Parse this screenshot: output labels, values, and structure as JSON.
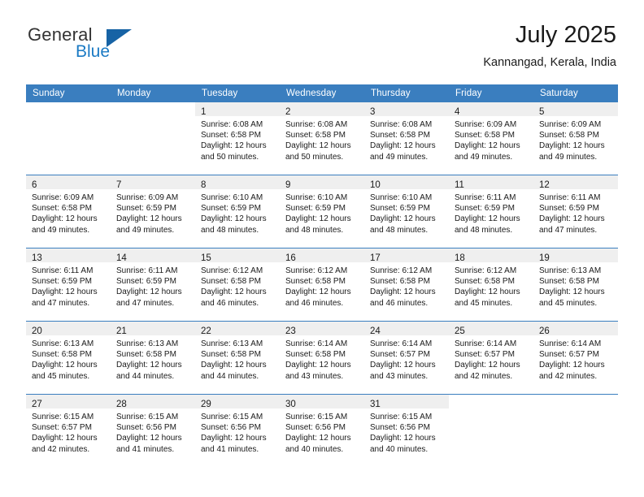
{
  "brand": {
    "name_part1": "General",
    "name_part2": "Blue",
    "triangle_color": "#1763a5",
    "blue_color": "#1b7ac4"
  },
  "header": {
    "title": "July 2025",
    "location": "Kannangad, Kerala, India"
  },
  "theme": {
    "header_band": "#3a7ebf",
    "daynum_band": "#efefef",
    "row_divider": "#3a7ebf",
    "text": "#1a1a1a"
  },
  "weekdays": [
    "Sunday",
    "Monday",
    "Tuesday",
    "Wednesday",
    "Thursday",
    "Friday",
    "Saturday"
  ],
  "labels": {
    "sunrise_prefix": "Sunrise: ",
    "sunset_prefix": "Sunset: ",
    "daylight_prefix": "Daylight: "
  },
  "weeks": [
    [
      {
        "day": "",
        "sunrise": "",
        "sunset": "",
        "daylight_l1": "",
        "daylight_l2": ""
      },
      {
        "day": "",
        "sunrise": "",
        "sunset": "",
        "daylight_l1": "",
        "daylight_l2": ""
      },
      {
        "day": "1",
        "sunrise": "Sunrise: 6:08 AM",
        "sunset": "Sunset: 6:58 PM",
        "daylight_l1": "Daylight: 12 hours",
        "daylight_l2": "and 50 minutes."
      },
      {
        "day": "2",
        "sunrise": "Sunrise: 6:08 AM",
        "sunset": "Sunset: 6:58 PM",
        "daylight_l1": "Daylight: 12 hours",
        "daylight_l2": "and 50 minutes."
      },
      {
        "day": "3",
        "sunrise": "Sunrise: 6:08 AM",
        "sunset": "Sunset: 6:58 PM",
        "daylight_l1": "Daylight: 12 hours",
        "daylight_l2": "and 49 minutes."
      },
      {
        "day": "4",
        "sunrise": "Sunrise: 6:09 AM",
        "sunset": "Sunset: 6:58 PM",
        "daylight_l1": "Daylight: 12 hours",
        "daylight_l2": "and 49 minutes."
      },
      {
        "day": "5",
        "sunrise": "Sunrise: 6:09 AM",
        "sunset": "Sunset: 6:58 PM",
        "daylight_l1": "Daylight: 12 hours",
        "daylight_l2": "and 49 minutes."
      }
    ],
    [
      {
        "day": "6",
        "sunrise": "Sunrise: 6:09 AM",
        "sunset": "Sunset: 6:58 PM",
        "daylight_l1": "Daylight: 12 hours",
        "daylight_l2": "and 49 minutes."
      },
      {
        "day": "7",
        "sunrise": "Sunrise: 6:09 AM",
        "sunset": "Sunset: 6:59 PM",
        "daylight_l1": "Daylight: 12 hours",
        "daylight_l2": "and 49 minutes."
      },
      {
        "day": "8",
        "sunrise": "Sunrise: 6:10 AM",
        "sunset": "Sunset: 6:59 PM",
        "daylight_l1": "Daylight: 12 hours",
        "daylight_l2": "and 48 minutes."
      },
      {
        "day": "9",
        "sunrise": "Sunrise: 6:10 AM",
        "sunset": "Sunset: 6:59 PM",
        "daylight_l1": "Daylight: 12 hours",
        "daylight_l2": "and 48 minutes."
      },
      {
        "day": "10",
        "sunrise": "Sunrise: 6:10 AM",
        "sunset": "Sunset: 6:59 PM",
        "daylight_l1": "Daylight: 12 hours",
        "daylight_l2": "and 48 minutes."
      },
      {
        "day": "11",
        "sunrise": "Sunrise: 6:11 AM",
        "sunset": "Sunset: 6:59 PM",
        "daylight_l1": "Daylight: 12 hours",
        "daylight_l2": "and 48 minutes."
      },
      {
        "day": "12",
        "sunrise": "Sunrise: 6:11 AM",
        "sunset": "Sunset: 6:59 PM",
        "daylight_l1": "Daylight: 12 hours",
        "daylight_l2": "and 47 minutes."
      }
    ],
    [
      {
        "day": "13",
        "sunrise": "Sunrise: 6:11 AM",
        "sunset": "Sunset: 6:59 PM",
        "daylight_l1": "Daylight: 12 hours",
        "daylight_l2": "and 47 minutes."
      },
      {
        "day": "14",
        "sunrise": "Sunrise: 6:11 AM",
        "sunset": "Sunset: 6:59 PM",
        "daylight_l1": "Daylight: 12 hours",
        "daylight_l2": "and 47 minutes."
      },
      {
        "day": "15",
        "sunrise": "Sunrise: 6:12 AM",
        "sunset": "Sunset: 6:58 PM",
        "daylight_l1": "Daylight: 12 hours",
        "daylight_l2": "and 46 minutes."
      },
      {
        "day": "16",
        "sunrise": "Sunrise: 6:12 AM",
        "sunset": "Sunset: 6:58 PM",
        "daylight_l1": "Daylight: 12 hours",
        "daylight_l2": "and 46 minutes."
      },
      {
        "day": "17",
        "sunrise": "Sunrise: 6:12 AM",
        "sunset": "Sunset: 6:58 PM",
        "daylight_l1": "Daylight: 12 hours",
        "daylight_l2": "and 46 minutes."
      },
      {
        "day": "18",
        "sunrise": "Sunrise: 6:12 AM",
        "sunset": "Sunset: 6:58 PM",
        "daylight_l1": "Daylight: 12 hours",
        "daylight_l2": "and 45 minutes."
      },
      {
        "day": "19",
        "sunrise": "Sunrise: 6:13 AM",
        "sunset": "Sunset: 6:58 PM",
        "daylight_l1": "Daylight: 12 hours",
        "daylight_l2": "and 45 minutes."
      }
    ],
    [
      {
        "day": "20",
        "sunrise": "Sunrise: 6:13 AM",
        "sunset": "Sunset: 6:58 PM",
        "daylight_l1": "Daylight: 12 hours",
        "daylight_l2": "and 45 minutes."
      },
      {
        "day": "21",
        "sunrise": "Sunrise: 6:13 AM",
        "sunset": "Sunset: 6:58 PM",
        "daylight_l1": "Daylight: 12 hours",
        "daylight_l2": "and 44 minutes."
      },
      {
        "day": "22",
        "sunrise": "Sunrise: 6:13 AM",
        "sunset": "Sunset: 6:58 PM",
        "daylight_l1": "Daylight: 12 hours",
        "daylight_l2": "and 44 minutes."
      },
      {
        "day": "23",
        "sunrise": "Sunrise: 6:14 AM",
        "sunset": "Sunset: 6:58 PM",
        "daylight_l1": "Daylight: 12 hours",
        "daylight_l2": "and 43 minutes."
      },
      {
        "day": "24",
        "sunrise": "Sunrise: 6:14 AM",
        "sunset": "Sunset: 6:57 PM",
        "daylight_l1": "Daylight: 12 hours",
        "daylight_l2": "and 43 minutes."
      },
      {
        "day": "25",
        "sunrise": "Sunrise: 6:14 AM",
        "sunset": "Sunset: 6:57 PM",
        "daylight_l1": "Daylight: 12 hours",
        "daylight_l2": "and 42 minutes."
      },
      {
        "day": "26",
        "sunrise": "Sunrise: 6:14 AM",
        "sunset": "Sunset: 6:57 PM",
        "daylight_l1": "Daylight: 12 hours",
        "daylight_l2": "and 42 minutes."
      }
    ],
    [
      {
        "day": "27",
        "sunrise": "Sunrise: 6:15 AM",
        "sunset": "Sunset: 6:57 PM",
        "daylight_l1": "Daylight: 12 hours",
        "daylight_l2": "and 42 minutes."
      },
      {
        "day": "28",
        "sunrise": "Sunrise: 6:15 AM",
        "sunset": "Sunset: 6:56 PM",
        "daylight_l1": "Daylight: 12 hours",
        "daylight_l2": "and 41 minutes."
      },
      {
        "day": "29",
        "sunrise": "Sunrise: 6:15 AM",
        "sunset": "Sunset: 6:56 PM",
        "daylight_l1": "Daylight: 12 hours",
        "daylight_l2": "and 41 minutes."
      },
      {
        "day": "30",
        "sunrise": "Sunrise: 6:15 AM",
        "sunset": "Sunset: 6:56 PM",
        "daylight_l1": "Daylight: 12 hours",
        "daylight_l2": "and 40 minutes."
      },
      {
        "day": "31",
        "sunrise": "Sunrise: 6:15 AM",
        "sunset": "Sunset: 6:56 PM",
        "daylight_l1": "Daylight: 12 hours",
        "daylight_l2": "and 40 minutes."
      },
      {
        "day": "",
        "sunrise": "",
        "sunset": "",
        "daylight_l1": "",
        "daylight_l2": ""
      },
      {
        "day": "",
        "sunrise": "",
        "sunset": "",
        "daylight_l1": "",
        "daylight_l2": ""
      }
    ]
  ]
}
